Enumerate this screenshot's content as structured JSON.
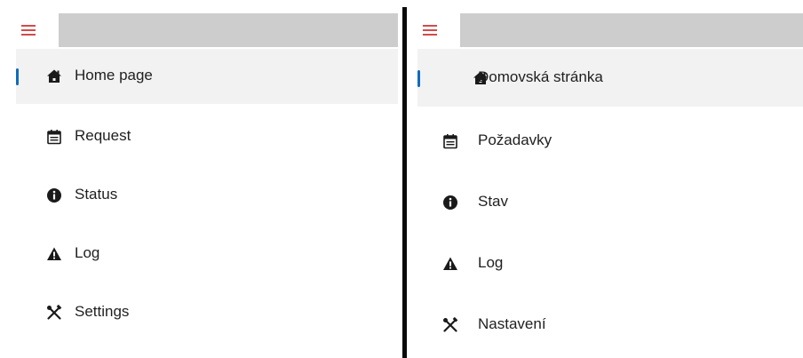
{
  "accent_color": "#0f6cbd",
  "hamburger_color": "#d44a4a",
  "panels": [
    {
      "language": "en",
      "search": {
        "placeholder": ""
      },
      "nav": [
        {
          "label": "Home page",
          "icon": "home-icon",
          "active": true
        },
        {
          "label": "Request",
          "icon": "calendar-icon",
          "active": false
        },
        {
          "label": "Status",
          "icon": "info-icon",
          "active": false
        },
        {
          "label": "Log",
          "icon": "warning-icon",
          "active": false
        },
        {
          "label": "Settings",
          "icon": "tools-icon",
          "active": false
        }
      ]
    },
    {
      "language": "cs",
      "search": {
        "placeholder": ""
      },
      "nav": [
        {
          "label": "Domovská stránka",
          "icon": "home-icon",
          "active": true
        },
        {
          "label": "Požadavky",
          "icon": "calendar-icon",
          "active": false
        },
        {
          "label": "Stav",
          "icon": "info-icon",
          "active": false
        },
        {
          "label": "Log",
          "icon": "warning-icon",
          "active": false
        },
        {
          "label": "Nastavení",
          "icon": "tools-icon",
          "active": false
        }
      ]
    }
  ]
}
